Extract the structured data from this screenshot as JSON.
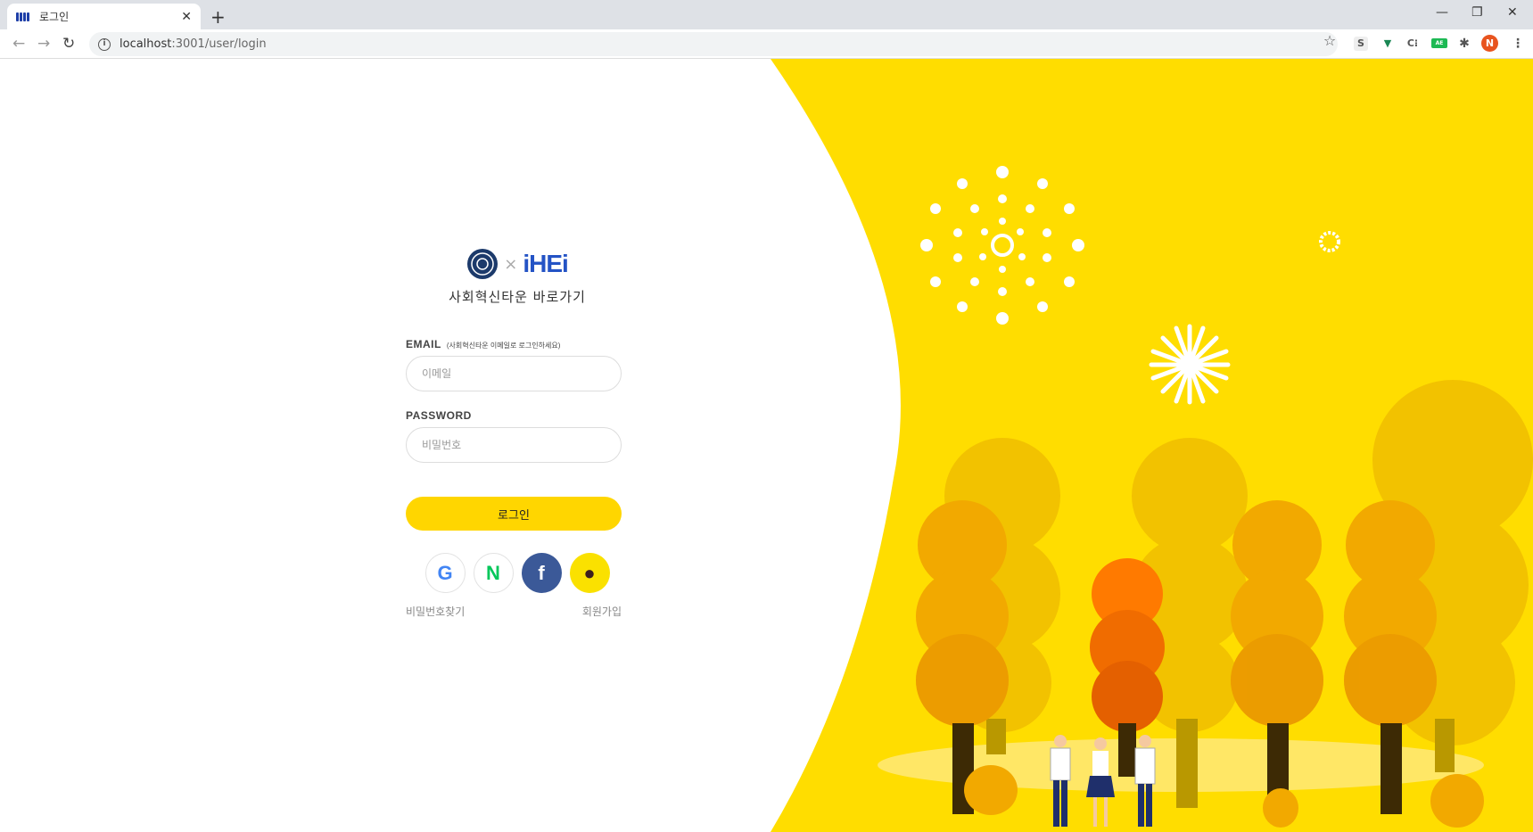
{
  "browser": {
    "tab_title": "로그인",
    "url_host": "localhost",
    "url_rest": ":3001/user/login",
    "profile_initial": "N"
  },
  "login": {
    "brand_title": "사회혁신타운 바로가기",
    "email_label": "EMAIL",
    "email_hint": "(사회혁신타운 이메일로 로그인하세요)",
    "email_placeholder": "이메일",
    "email_value": "",
    "password_label": "PASSWORD",
    "password_placeholder": "비밀번호",
    "password_value": "",
    "login_button": "로그인",
    "find_password_link": "비밀번호찾기",
    "signup_link": "회원가입",
    "logo_text": "iHEi"
  },
  "social": [
    {
      "name": "google",
      "glyph": "G",
      "bg": "#ffffff",
      "color": "#4285f4"
    },
    {
      "name": "naver",
      "glyph": "N",
      "bg": "#ffffff",
      "color": "#03c75a"
    },
    {
      "name": "facebook",
      "glyph": "f",
      "bg": "#3b5998",
      "color": "#ffffff"
    },
    {
      "name": "kakao",
      "glyph": "●",
      "bg": "#fae100",
      "color": "#3c1e1e"
    }
  ],
  "colors": {
    "accent": "#ffd600",
    "illustration_bg": "#ffdd00"
  }
}
